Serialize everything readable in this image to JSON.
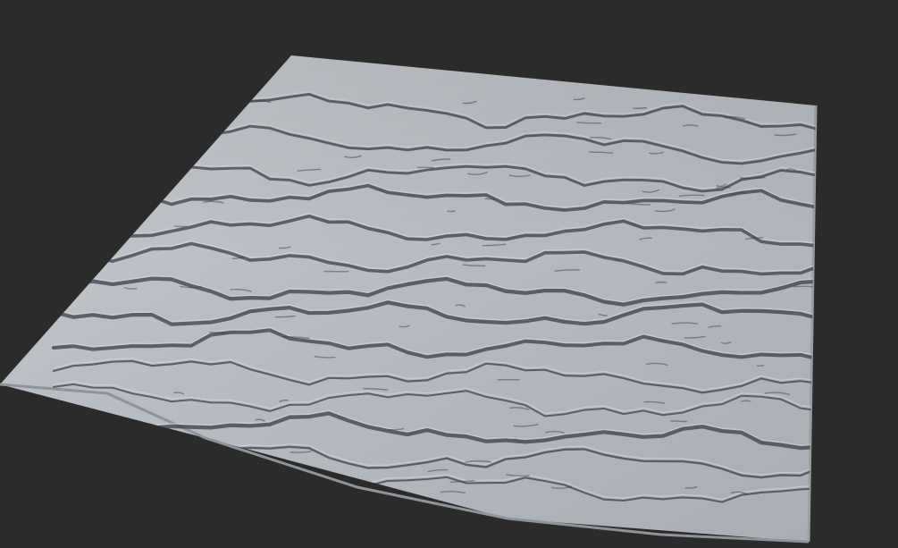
{
  "viewport": {
    "background_color": "#2b2b2b",
    "subject": "terrain-mesh",
    "shading": "matcap-gray"
  },
  "terrain": {
    "surface_color": "#b4b9bf",
    "ridge_color": "#3c4149",
    "highlight_color": "#d6dadf"
  }
}
